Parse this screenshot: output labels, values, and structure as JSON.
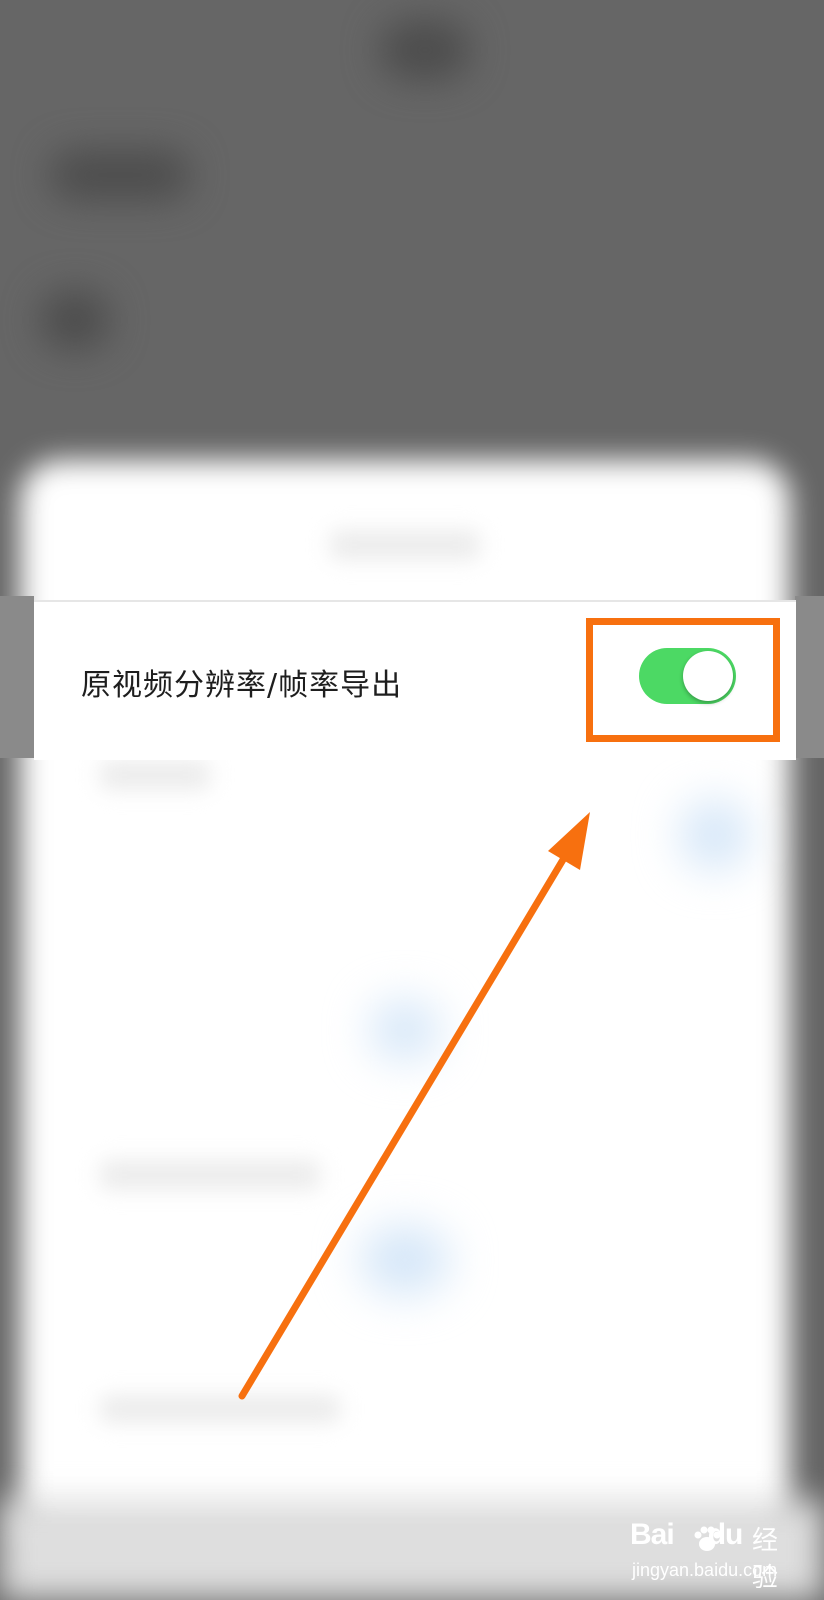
{
  "setting": {
    "label": "原视频分辨率/帧率导出",
    "toggle_on": true
  },
  "colors": {
    "toggle_on": "#4cd964",
    "highlight": "#f7700f",
    "backdrop": "#666666"
  },
  "watermark": {
    "logo": "Bai",
    "logo_suffix": "du",
    "brand": "经验",
    "url": "jingyan.baidu.com"
  }
}
